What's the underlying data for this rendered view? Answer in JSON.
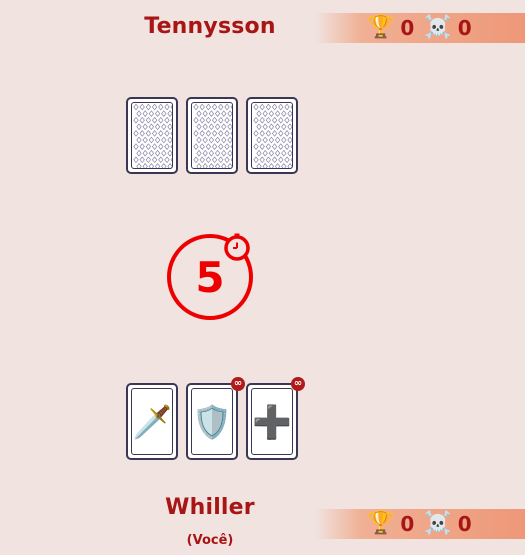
{
  "opponent": {
    "name": "Tennysson",
    "trophies": "0",
    "skulls": "0",
    "hand_count": 3
  },
  "player": {
    "name": "Whiller",
    "tag": "(Você)",
    "trophies": "0",
    "skulls": "0",
    "cards": [
      {
        "icon": "dagger-icon",
        "glyph": "🗡️",
        "infinite": false
      },
      {
        "icon": "shield-icon",
        "glyph": "🛡️",
        "infinite": true,
        "badge": "∞"
      },
      {
        "icon": "plus-icon",
        "glyph": "➕",
        "infinite": true,
        "badge": "∞"
      }
    ]
  },
  "timer": {
    "value": "5"
  },
  "icons": {
    "trophy": "🏆",
    "skull": "☠️"
  },
  "colors": {
    "background": "#f0e3e0",
    "accent": "#a81515",
    "timer": "#ee0000",
    "card_border": "#3b3653"
  }
}
